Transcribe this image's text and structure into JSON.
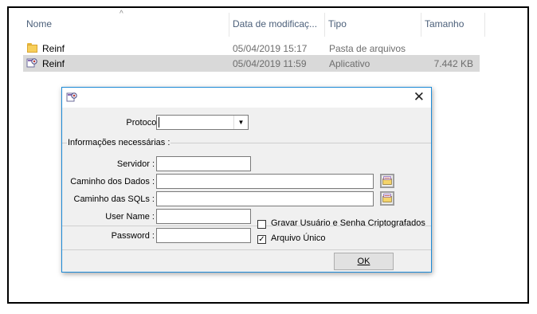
{
  "explorer": {
    "columns": {
      "name": "Nome",
      "date": "Data de modificaç...",
      "type": "Tipo",
      "size": "Tamanho"
    },
    "sort_caret": "^",
    "rows": [
      {
        "name": "Reinf",
        "date": "05/04/2019 15:17",
        "type": "Pasta de arquivos",
        "size": "",
        "icon": "folder-icon"
      },
      {
        "name": "Reinf",
        "date": "05/04/2019 11:59",
        "type": "Aplicativo",
        "size": "7.442 KB",
        "icon": "application-icon",
        "selected": true
      }
    ]
  },
  "dialog": {
    "close_glyph": "✕",
    "protocolo_label": "Protocolo :",
    "protocolo_value": "",
    "dropdown_glyph": "▼",
    "group_title": "Informações necessárias :",
    "fields": {
      "servidor": {
        "label": "Servidor :",
        "value": ""
      },
      "caminho_dados": {
        "label": "Caminho dos Dados :",
        "value": ""
      },
      "caminho_sqls": {
        "label": "Caminho das SQLs :",
        "value": ""
      },
      "user_name": {
        "label": "User Name :",
        "value": ""
      },
      "password": {
        "label": "Password :",
        "value": ""
      }
    },
    "checkboxes": {
      "gravar": {
        "label": "Gravar Usuário e Senha Criptografados",
        "checked": false,
        "mark": ""
      },
      "arquivo_unico": {
        "label": "Arquivo Único",
        "checked": true,
        "mark": "✓"
      }
    },
    "ok_label": "OK",
    "colors": {
      "accent_border": "#1c8ad6",
      "selection": "#d9d9d9",
      "folder": "#f7cf5a"
    }
  }
}
